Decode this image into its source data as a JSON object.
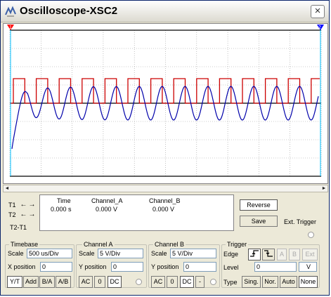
{
  "window": {
    "title": "Oscilloscope-XSC2",
    "close_glyph": "×"
  },
  "screen": {
    "background": "#ffffff",
    "grid_color": "#999999",
    "cursor_t1_color": "#ff0000",
    "cursor_t2_color": "#0000ff",
    "cursor_t1_label": "1",
    "cursor_t2_label": "2",
    "channel_a_color": "#cc0000",
    "channel_b_color": "#0000aa"
  },
  "readout": {
    "cursor_labels": [
      "T1",
      "T2",
      "T2-T1"
    ],
    "headers": {
      "time": "Time",
      "channel_a": "Channel_A",
      "channel_b": "Channel_B"
    },
    "t1": {
      "time": "0.000 s",
      "channel_a": "0.000 V",
      "channel_b": "0.000 V"
    },
    "arrow_left": "←",
    "arrow_right": "→"
  },
  "buttons": {
    "reverse": "Reverse",
    "save": "Save",
    "ext_trigger": "Ext. Trigger"
  },
  "timebase": {
    "title": "Timebase",
    "scale_label": "Scale",
    "scale_value": "500 us/Div",
    "xpos_label": "X position",
    "xpos_value": "0",
    "modes": [
      "Y/T",
      "Add",
      "B/A",
      "A/B"
    ],
    "selected_mode": "Y/T"
  },
  "channel_a": {
    "title": "Channel A",
    "scale_label": "Scale",
    "scale_value": "5  V/Div",
    "ypos_label": "Y position",
    "ypos_value": "0",
    "couplings": [
      "AC",
      "0",
      "DC"
    ],
    "selected_coupling": "DC"
  },
  "channel_b": {
    "title": "Channel B",
    "scale_label": "Scale",
    "scale_value": "5  V/Div",
    "ypos_label": "Y position",
    "ypos_value": "0",
    "couplings": [
      "AC",
      "0",
      "DC",
      "-"
    ],
    "selected_coupling": "DC"
  },
  "trigger": {
    "title": "Trigger",
    "edge_label": "Edge",
    "sources": [
      "A",
      "B",
      "Ext"
    ],
    "level_label": "Level",
    "level_value": "0",
    "level_unit": "V",
    "type_label": "Type",
    "types": [
      "Sing.",
      "Nor.",
      "Auto",
      "None"
    ],
    "selected_type": "None"
  },
  "scroll": {
    "left": "◄",
    "right": "►"
  }
}
